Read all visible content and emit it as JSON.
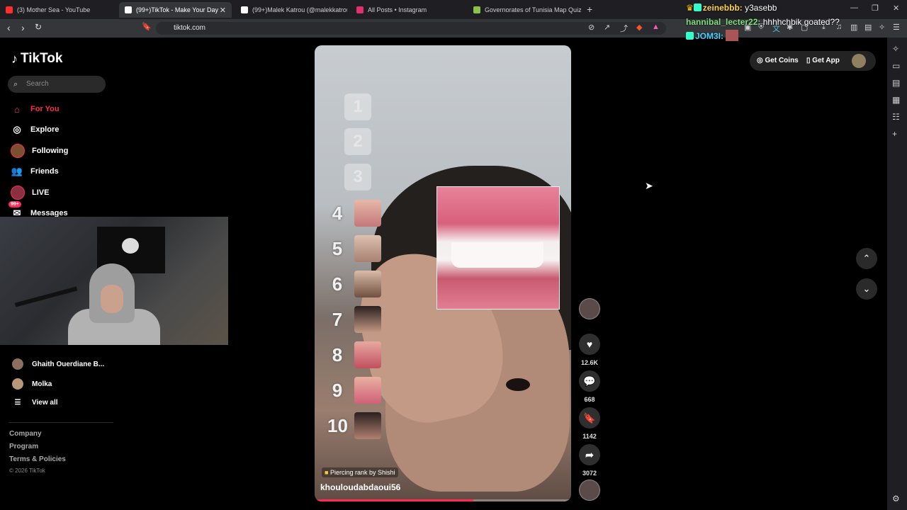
{
  "browser": {
    "tabs": [
      {
        "label": "(3) Mother Sea - YouTube",
        "color": "#ff2d2d",
        "active": false
      },
      {
        "label": "(99+)TikTok - Make Your Day",
        "color": "#ffffff",
        "active": true
      },
      {
        "label": "(99+)Malek Katrou (@malekkatrou) |",
        "color": "#ffffff",
        "active": false
      },
      {
        "label": "All Posts • Instagram",
        "color": "#e1306c",
        "active": false
      },
      {
        "label": "Governorates of Tunisia Map Quiz",
        "color": "#8bc34a",
        "active": false
      }
    ],
    "new_tab": "+",
    "url": "tiktok.com"
  },
  "chat": [
    {
      "user": "zeinebbb:",
      "message": "y3asebb"
    },
    {
      "user": "hannibal_lecter22:",
      "message": "hhhhchbik goated??"
    },
    {
      "user": "JOM3I:",
      "message": ""
    }
  ],
  "sidebar": {
    "logo": "TikTok",
    "search_placeholder": "Search",
    "nav": [
      {
        "label": "For You",
        "icon": "home-icon",
        "active": true
      },
      {
        "label": "Explore",
        "icon": "compass-icon",
        "active": false
      },
      {
        "label": "Following",
        "icon": "following-icon",
        "active": false
      },
      {
        "label": "Friends",
        "icon": "friends-icon",
        "active": false
      },
      {
        "label": "LIVE",
        "icon": "live-icon",
        "active": false
      },
      {
        "label": "Messages",
        "icon": "messages-icon",
        "active": false,
        "badge": "99+"
      }
    ],
    "following": [
      {
        "name": "Ghaith Ouerdiane B..."
      },
      {
        "name": "Molka"
      }
    ],
    "view_all": "View all",
    "footer": [
      "Company",
      "Program",
      "Terms & Policies"
    ],
    "copyright": "© 2026 TikTok"
  },
  "video": {
    "rank_title": "Piercing rank by Shishi",
    "creator": "khouloudabdaoui56",
    "ranks": [
      "1",
      "2",
      "3",
      "4",
      "5",
      "6",
      "7",
      "8",
      "9",
      "10"
    ],
    "progress": 0.62
  },
  "actions": {
    "likes": "12.6K",
    "comments": "668",
    "saves": "1142",
    "shares": "3072"
  },
  "header": {
    "get_coins": "Get Coins",
    "get_app": "Get App"
  }
}
